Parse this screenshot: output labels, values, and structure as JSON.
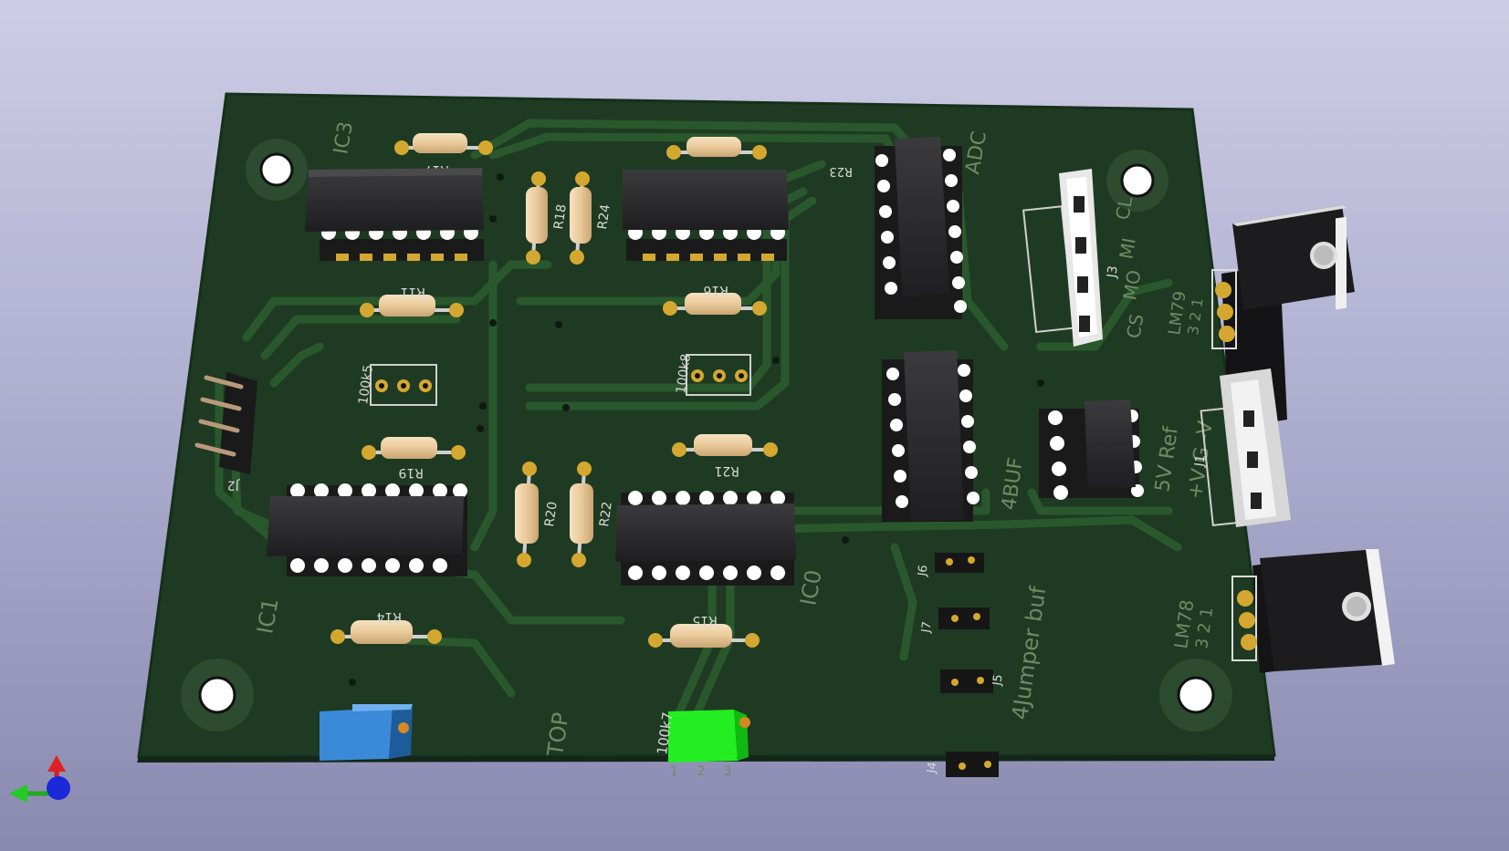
{
  "colors": {
    "board": "#1f3a22",
    "board_edge": "#16301a",
    "trace": "#2b5a2e",
    "pad": "#d4a830",
    "ic_body": "#2a2a2c",
    "resistor": "#e9c99a",
    "trimmer_blue": "#3a8ad8",
    "trimmer_green": "#22ee22",
    "background_top": "#cdcde6",
    "background_bottom": "#8a8ab0"
  },
  "silkscreen": {
    "ic3": "IC3",
    "ic1": "IC1",
    "ic0": "IC0",
    "adc": "ADC",
    "top": "TOP",
    "buf_4": "4BUF",
    "ref_5v": "5V Ref",
    "supply_pins": "+V G -V",
    "jumper_buf": "4Jumper buf",
    "lm79": "LM79",
    "lm79_pins": "3 2 1",
    "lm78": "LM78",
    "lm78_pins": "3 2 1",
    "pot_100k5": "100k5",
    "pot_100k8": "100k8",
    "pot_100k7": "100k7",
    "pot_pins": "1 2 3",
    "cl": "CL",
    "mi": "MI",
    "mo": "MO",
    "cs": "CS"
  },
  "refdes": {
    "r17": "R17",
    "r18": "R18",
    "r24": "R24",
    "r23": "R23",
    "r11": "R11",
    "r16": "R16",
    "r19": "R19",
    "r20": "R20",
    "r22": "R22",
    "r21": "R21",
    "r14": "R14",
    "r15": "R15",
    "j1": "J1",
    "j2": "J2",
    "j3": "J3",
    "j4": "J4",
    "j5": "J5",
    "j6": "J6",
    "j7": "J7"
  },
  "axes_gizmo": [
    "x-axis",
    "y-axis",
    "z-axis"
  ]
}
